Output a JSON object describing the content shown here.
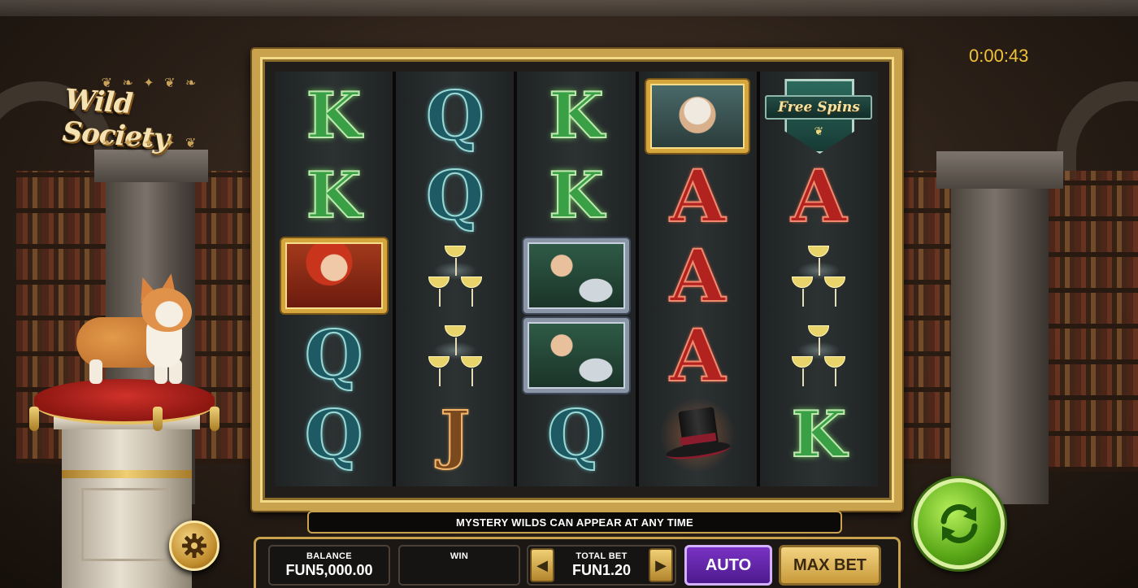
{
  "game": {
    "logo_text": "Wild Society",
    "timer": "0:00:43"
  },
  "reels": [
    [
      "K",
      "K",
      "lady-portrait",
      "Q",
      "Q"
    ],
    [
      "Q",
      "Q",
      "champagne-tower",
      "champagne-tower",
      "J"
    ],
    [
      "K",
      "K",
      "butler-portrait",
      "butler-portrait",
      "Q"
    ],
    [
      "old-gentleman-portrait",
      "A",
      "A",
      "A",
      "top-hat"
    ],
    [
      "free-spins-badge",
      "A",
      "champagne-tower",
      "champagne-tower",
      "K"
    ]
  ],
  "symbols": {
    "free_spins_label": "Free Spins"
  },
  "message_bar": "MYSTERY WILDS CAN APPEAR AT ANY TIME",
  "console": {
    "balance_label": "BALANCE",
    "balance_value": "FUN5,000.00",
    "win_label": "WIN",
    "win_value": "",
    "total_bet_label": "TOTAL BET",
    "total_bet_value": "FUN1.20",
    "auto_label": "AUTO",
    "max_bet_label": "MAX BET"
  },
  "icons": {
    "settings": "gear-icon",
    "spin": "refresh-icon",
    "bet_decrease": "chevron-left-icon",
    "bet_increase": "chevron-right-icon"
  },
  "colors": {
    "frame_gold": "#c9a24e",
    "spin_green": "#5aa818",
    "auto_purple": "#6a2bb0",
    "timer_yellow": "#f0c23a"
  }
}
